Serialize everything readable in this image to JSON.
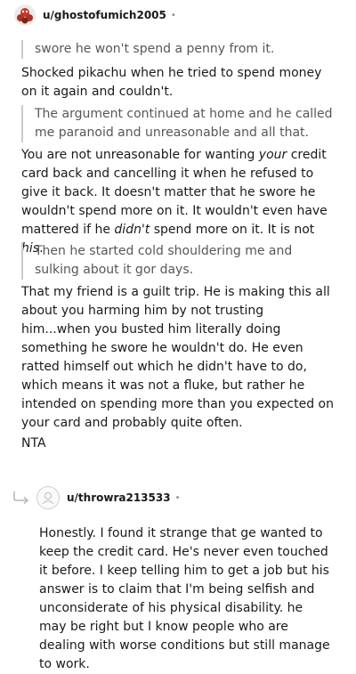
{
  "comment": {
    "username": "u/ghostofumich2005",
    "separator": "•",
    "quote1": "swore he won't spend a penny from it.",
    "para1": "Shocked pikachu when he tried to spend money on it again and couldn't.",
    "quote2": "The argument continued at home and he called me paranoid and unreasonable and all that.",
    "para2_parts": [
      "You are not unreasonable for wanting ",
      "your",
      " credit card back and cancelling it when he refused to give it back. It doesn't matter that he swore he wouldn't spend more on it. It wouldn't even have mattered if he ",
      "didn't",
      " spend more on it. It is not ",
      "his",
      "."
    ],
    "quote3": "Then he started cold shouldering me and sulking about it gor days.",
    "para3": "That my friend is a guilt trip. He is making this all about you harming him by not trusting him...when you busted him literally doing something he swore he wouldn't do. He even ratted himself out which he didn't have to do, which means it was not a fluke, but rather he intended on spending more than you expected on your card and probably quite often.",
    "verdict": "NTA"
  },
  "reply": {
    "username": "u/throwra213533",
    "separator": "•",
    "body": "Honestly. I found it strange that ge wanted to keep the credit card. He's never even touched it before. I keep telling him to get a job but his answer is to claim that I'm being selfish and unconsiderate of his physical disability. he may be right but I know people who are dealing with worse conditions but still manage to work."
  }
}
